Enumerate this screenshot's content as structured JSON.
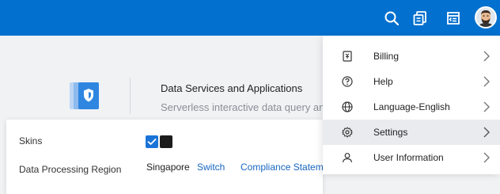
{
  "topbar": {
    "icons": [
      "search-icon",
      "notifications-icon",
      "tickets-icon"
    ],
    "avatar": "user-avatar"
  },
  "product": {
    "title": "Data Services and Applications",
    "subtitle": "Serverless interactive data query and analysis"
  },
  "settings_panel": {
    "skins_label": "Skins",
    "skins": [
      {
        "color": "#1a74d8",
        "selected": true
      },
      {
        "color": "#1c1c1c",
        "selected": false
      }
    ],
    "region_label": "Data Processing Region",
    "region_value": "Singapore",
    "switch_link": "Switch",
    "compliance_link": "Compliance Statement"
  },
  "user_menu": {
    "items": [
      {
        "label": "Billing",
        "icon": "billing-icon",
        "active": false
      },
      {
        "label": "Help",
        "icon": "help-icon",
        "active": false
      },
      {
        "label": "Language-English",
        "icon": "globe-icon",
        "active": false
      },
      {
        "label": "Settings",
        "icon": "gear-icon",
        "active": true
      },
      {
        "label": "User Information",
        "icon": "user-icon",
        "active": false
      }
    ]
  },
  "colors": {
    "topbar": "#0170ce",
    "link": "#1765c1",
    "menu_active": "#e9ebee"
  }
}
